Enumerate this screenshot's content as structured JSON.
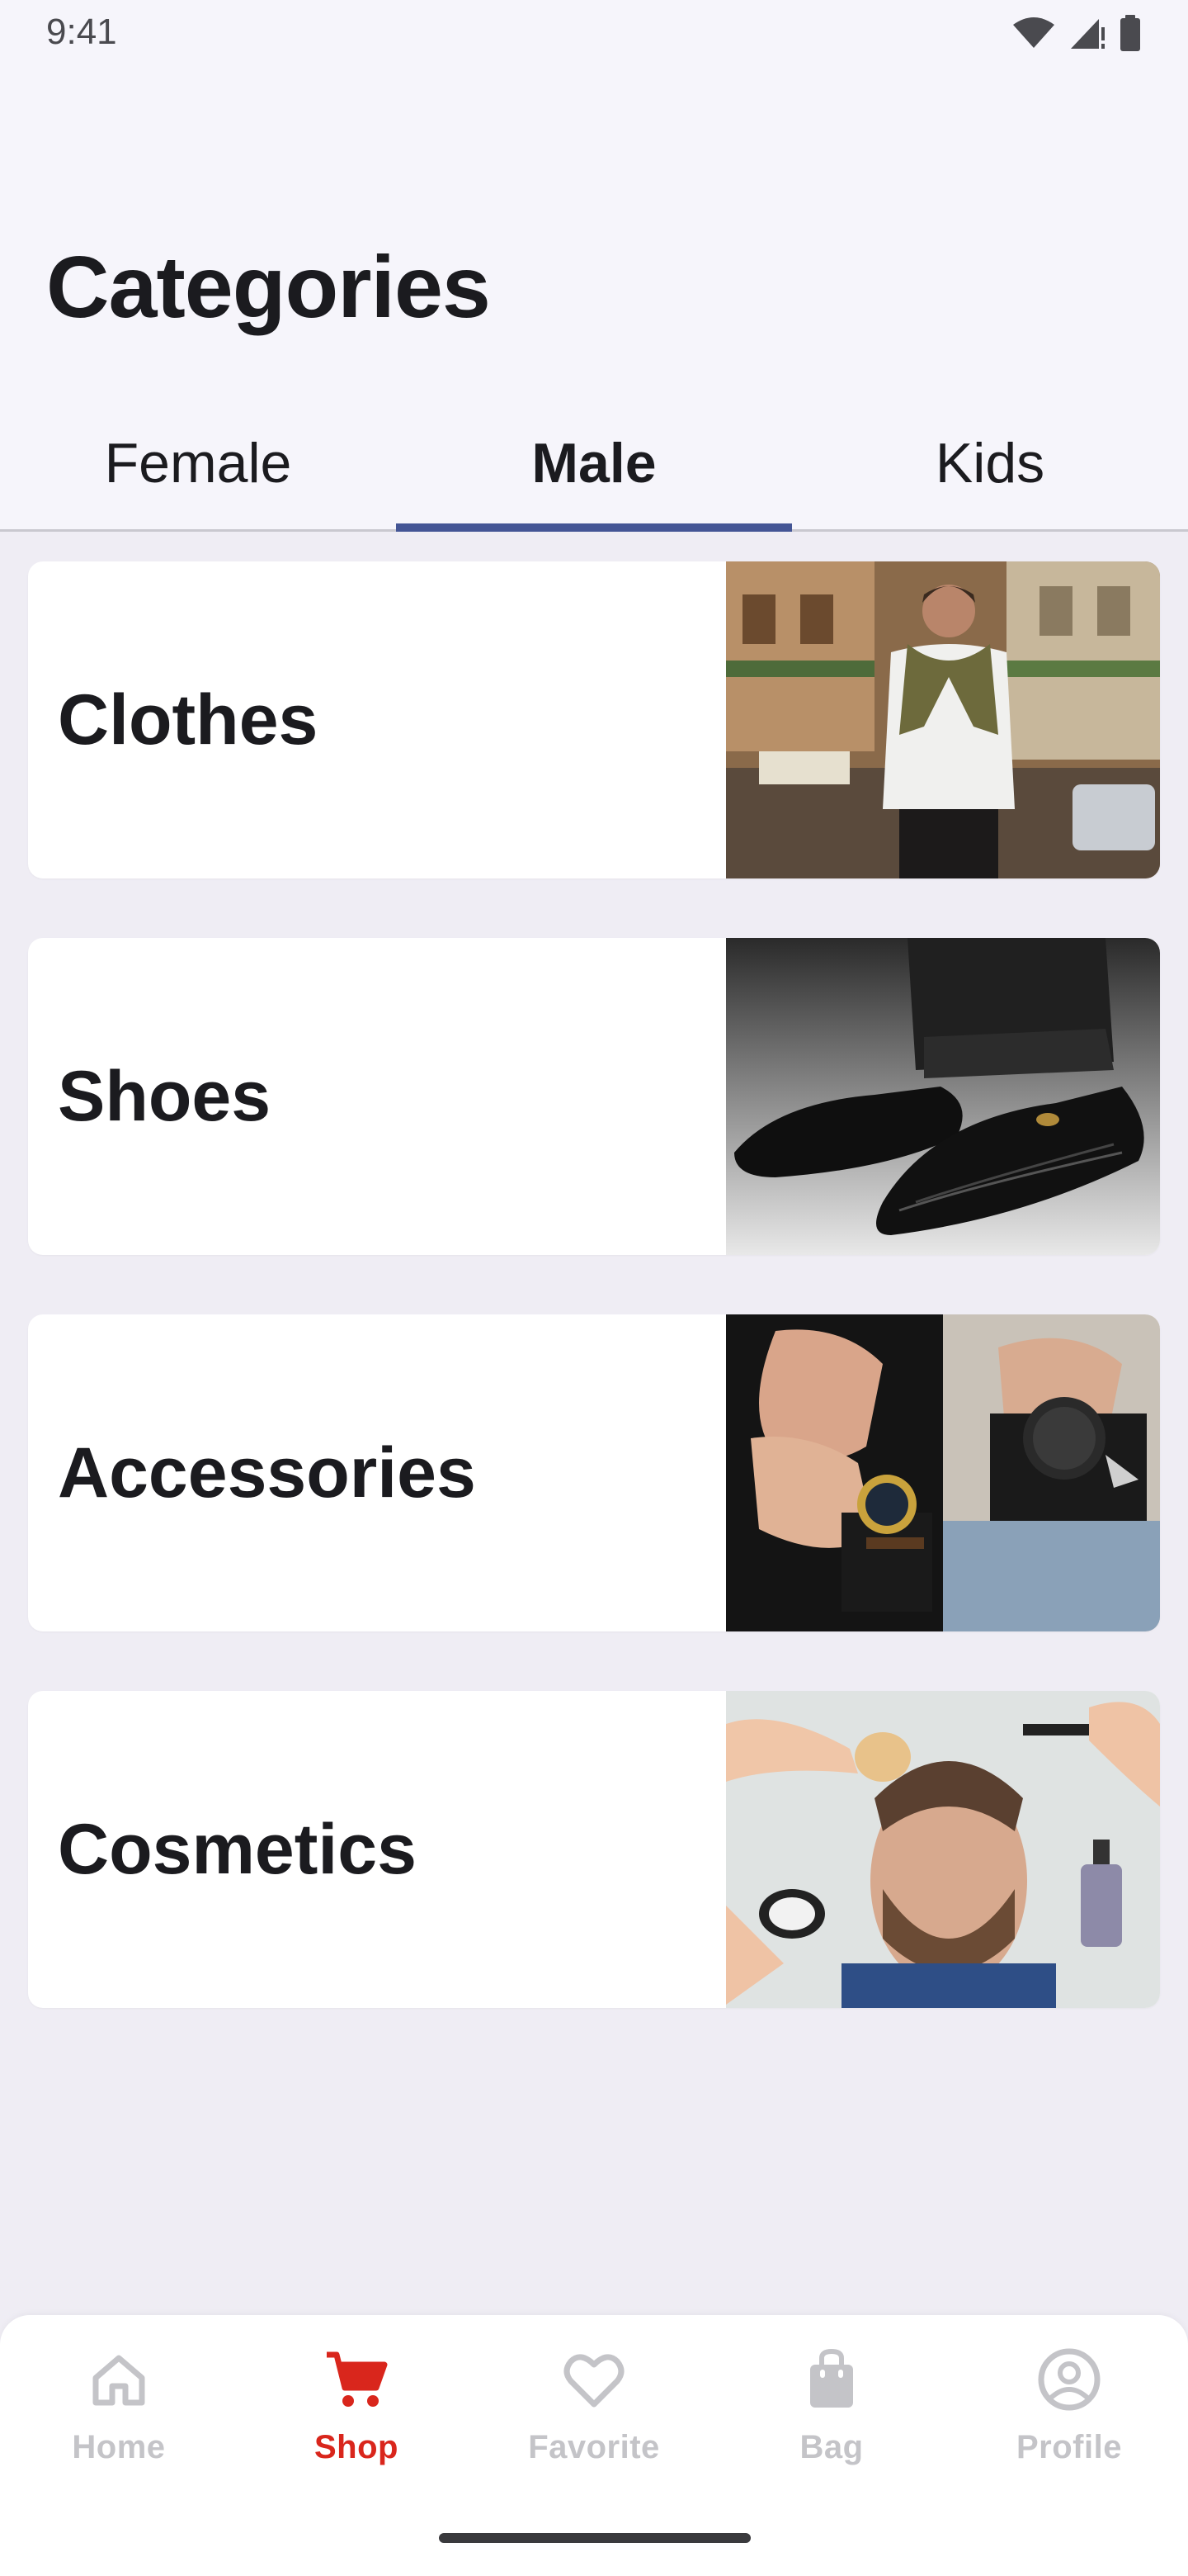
{
  "status_bar": {
    "time": "9:41"
  },
  "page": {
    "title": "Categories"
  },
  "tabs": [
    {
      "label": "Female",
      "active": false
    },
    {
      "label": "Male",
      "active": true
    },
    {
      "label": "Kids",
      "active": false
    }
  ],
  "categories": [
    {
      "label": "Clothes",
      "image": "man-in-white-shirt-on-street-photo"
    },
    {
      "label": "Shoes",
      "image": "black-leather-dress-shoes-photo"
    },
    {
      "label": "Accessories",
      "image": "wrist-watches-and-bracelets-photo"
    },
    {
      "label": "Cosmetics",
      "image": "bearded-man-grooming-products-photo"
    }
  ],
  "bottom_nav": [
    {
      "label": "Home",
      "icon": "home-icon",
      "active": false
    },
    {
      "label": "Shop",
      "icon": "cart-icon",
      "active": true
    },
    {
      "label": "Favorite",
      "icon": "heart-icon",
      "active": false
    },
    {
      "label": "Bag",
      "icon": "bag-icon",
      "active": false
    },
    {
      "label": "Profile",
      "icon": "profile-icon",
      "active": false
    }
  ],
  "colors": {
    "accent_tab": "#445595",
    "active_nav": "#d9261c",
    "inactive_nav": "#c4c4c8",
    "background": "#efedf4"
  }
}
